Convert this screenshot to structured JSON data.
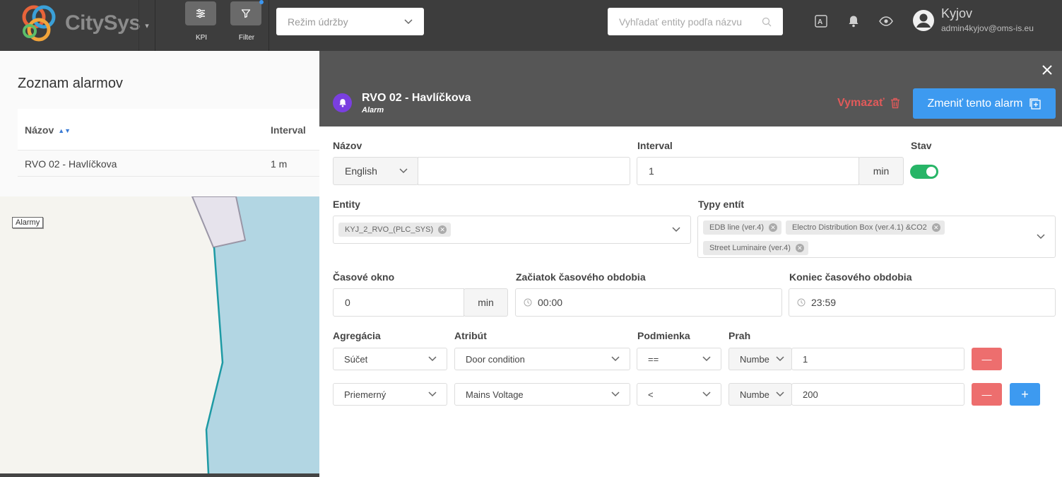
{
  "header": {
    "logo_text": "CitySys",
    "tools": [
      {
        "label": "KPI",
        "icon": "sliders-icon"
      },
      {
        "label": "Filter",
        "icon": "filter-icon"
      }
    ],
    "mode_placeholder": "Režim údržby",
    "search_placeholder": "Vyhľadať entity podľa názvu",
    "user": {
      "name": "Kyjov",
      "email": "admin4kyjov@oms-is.eu"
    }
  },
  "list": {
    "title": "Zoznam alarmov",
    "columns": [
      "Názov",
      "Interval"
    ],
    "rows": [
      {
        "name": "RVO 02 - Havlíčkova",
        "interval": "1 m"
      }
    ]
  },
  "map": {
    "label": "Alarmy"
  },
  "detail": {
    "title": "RVO 02 - Havlíčkova",
    "subtitle": "Alarm",
    "delete_label": "Vymazať",
    "change_label": "Zmeniť tento alarm",
    "labels": {
      "name": "Názov",
      "interval": "Interval",
      "state": "Stav",
      "entity": "Entity",
      "entity_types": "Typy entít",
      "time_window": "Časové okno",
      "period_start": "Začiatok časového obdobia",
      "period_end": "Koniec časového obdobia",
      "aggregation": "Agregácia",
      "attribute": "Atribút",
      "condition": "Podmienka",
      "threshold": "Prah"
    },
    "name_language": "English",
    "name_value": "",
    "interval_value": "1",
    "interval_unit": "min",
    "state_on": true,
    "entity_chips": [
      "KYJ_2_RVO_(PLC_SYS)"
    ],
    "entity_type_chips": [
      "EDB line (ver.4)",
      "Electro Distribution Box (ver.4.1) &CO2",
      "Street Luminaire (ver.4)"
    ],
    "time_window_value": "0",
    "time_window_unit": "min",
    "period_start_value": "00:00",
    "period_end_value": "23:59",
    "rules": [
      {
        "aggregation": "Súčet",
        "attribute": "Door condition",
        "condition": "==",
        "type": "Numbe",
        "threshold": "1"
      },
      {
        "aggregation": "Priemerný",
        "attribute": "Mains Voltage",
        "condition": "<",
        "type": "Numbe",
        "threshold": "200"
      }
    ],
    "colors": {
      "accent": "#3d9af0",
      "danger": "#ed6e6e",
      "toggle": "#27b567",
      "avatar": "#7a3fe0"
    }
  }
}
